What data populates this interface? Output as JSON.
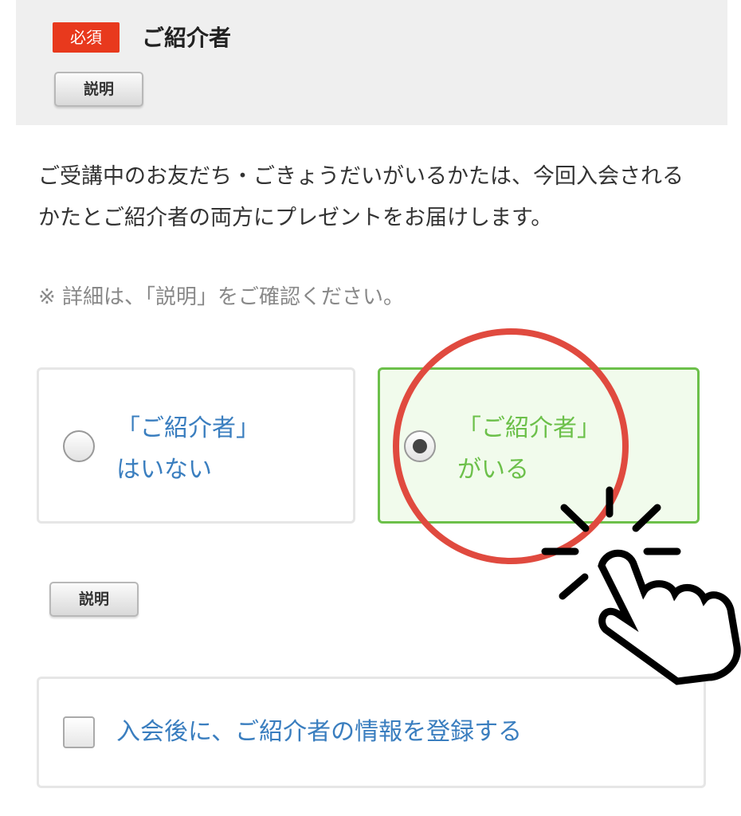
{
  "header": {
    "required_badge": "必須",
    "title": "ご紹介者",
    "explain_button": "説明"
  },
  "description": {
    "text": "ご受講中のお友だち・ごきょうだいがいるかたは、今回入会されるかたとご紹介者の両方にプレゼントをお届けします。",
    "note": "※ 詳細は、「説明」をご確認ください。"
  },
  "options": [
    {
      "line1": "「ご紹介者」",
      "line2": "はいない",
      "selected": false
    },
    {
      "line1": "「ご紹介者」",
      "line2": "がいる",
      "selected": true
    }
  ],
  "explain_button_2": "説明",
  "checkbox": {
    "label": "入会後に、ご紹介者の情報を登録する",
    "checked": false
  },
  "annotation": {
    "circle_color": "#e04a3f",
    "icon": "tap-hand-icon"
  },
  "colors": {
    "accent_blue": "#3a7ebf",
    "accent_green": "#6cc04a",
    "badge_red": "#e8391d"
  }
}
